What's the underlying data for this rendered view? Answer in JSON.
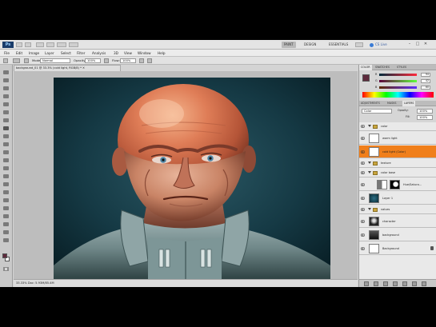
{
  "workspaces": [
    "PAINT",
    "DESIGN",
    "ESSENTIALS"
  ],
  "cs_live": "CS Live",
  "menu": [
    "File",
    "Edit",
    "Image",
    "Layer",
    "Select",
    "Filter",
    "Analysis",
    "3D",
    "View",
    "Window",
    "Help"
  ],
  "options_bar": {
    "mode_label": "Mode:",
    "mode_value": "Normal",
    "opacity_label": "Opacity:",
    "opacity_value": "100%",
    "flow_label": "Flow:",
    "flow_value": "100%"
  },
  "document_tab": "background_01 @ 33.3% (cold light, RGB/8) *  ✕",
  "status_text": "33.33%    Doc: 5.93M/85.4M",
  "color_panel": {
    "tabs": [
      "COLOR",
      "SWATCHES",
      "STYLES"
    ],
    "rows": [
      {
        "label": "R",
        "value": "94"
      },
      {
        "label": "G",
        "value": "42"
      },
      {
        "label": "B",
        "value": "60"
      }
    ]
  },
  "layers_panel": {
    "tabs": [
      "ADJUSTMENTS",
      "MASKS",
      "LAYERS"
    ],
    "blend_mode": "Color",
    "opacity_label": "Opacity:",
    "opacity_value": "100%",
    "fill_label": "Fill:",
    "fill_value": "100%",
    "layers": [
      {
        "name": "color",
        "kind": "group"
      },
      {
        "name": "warm light",
        "kind": "layer"
      },
      {
        "name": "cold light (Color)",
        "kind": "layer",
        "selected": true
      },
      {
        "name": "texture",
        "kind": "group"
      },
      {
        "name": "color base",
        "kind": "group"
      },
      {
        "name": "Hue/Satura...",
        "kind": "adjustment"
      },
      {
        "name": "Layer 1",
        "kind": "layer"
      },
      {
        "name": "values",
        "kind": "group"
      },
      {
        "name": "character",
        "kind": "layer"
      },
      {
        "name": "background",
        "kind": "layer"
      },
      {
        "name": "Background",
        "kind": "background"
      }
    ]
  },
  "colors": {
    "accent_selected": "#f07f1b",
    "foreground": "#5e2a3c",
    "background": "#ffffff"
  }
}
